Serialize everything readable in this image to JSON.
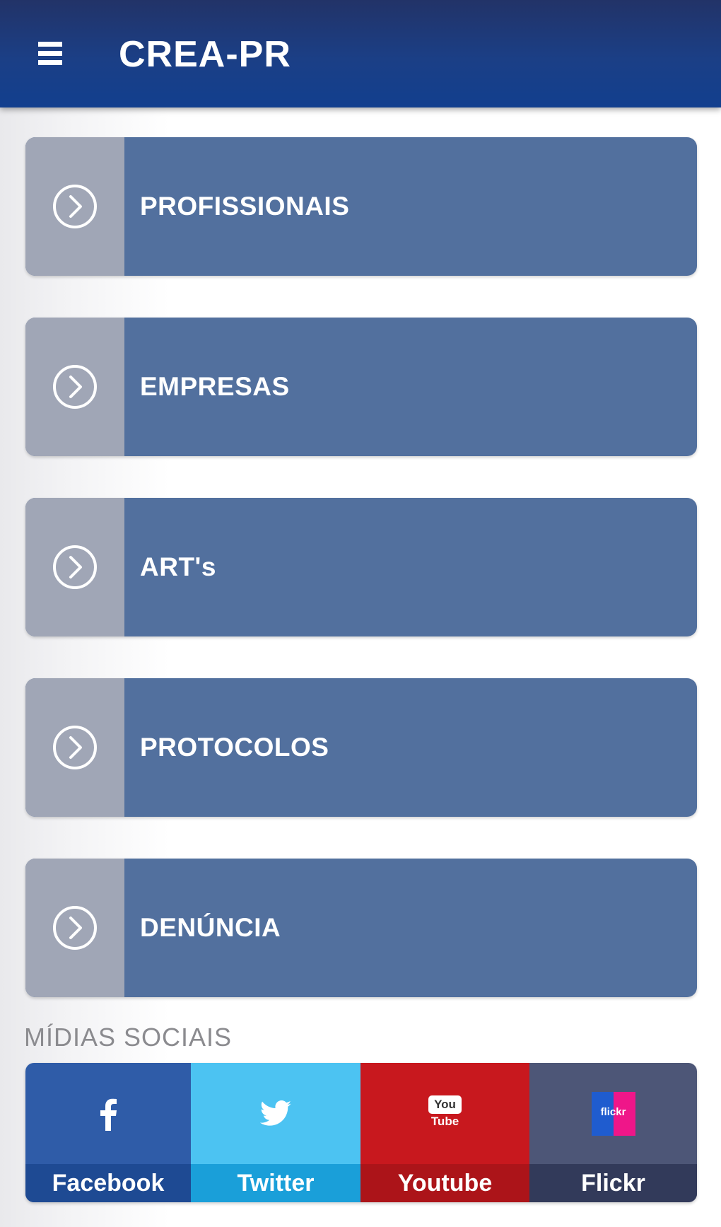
{
  "header": {
    "title": "CREA-PR",
    "menu_icon": "hamburger-menu-icon"
  },
  "menu": {
    "items": [
      {
        "label": "PROFISSIONAIS",
        "icon": "chevron-right-circle-icon"
      },
      {
        "label": "EMPRESAS",
        "icon": "chevron-right-circle-icon"
      },
      {
        "label": "ART's",
        "icon": "chevron-right-circle-icon"
      },
      {
        "label": "PROTOCOLOS",
        "icon": "chevron-right-circle-icon"
      },
      {
        "label": "DENÚNCIA",
        "icon": "chevron-right-circle-icon"
      }
    ]
  },
  "social": {
    "title": "MÍDIAS SOCIAIS",
    "items": [
      {
        "label": "Facebook",
        "icon": "facebook-icon",
        "color": "#2f5ca8",
        "label_color": "#1e4a93"
      },
      {
        "label": "Twitter",
        "icon": "twitter-icon",
        "color": "#4cc3f2",
        "label_color": "#1a9fd9"
      },
      {
        "label": "Youtube",
        "icon": "youtube-icon",
        "color": "#c8181e",
        "label_color": "#ac1419"
      },
      {
        "label": "Flickr",
        "icon": "flickr-icon",
        "color": "#4d5677",
        "label_color": "#323a5a"
      }
    ],
    "youtube_logo_text": [
      "You",
      "Tube"
    ],
    "flickr_logo_text": "flickr"
  },
  "colors": {
    "header": "#1b3f86",
    "menu_item": "#52709e",
    "menu_icon_cell": "#a0a6b6"
  }
}
